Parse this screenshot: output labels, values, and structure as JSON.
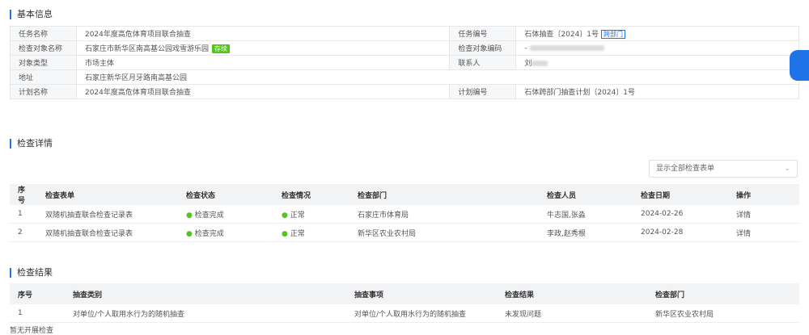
{
  "basic": {
    "title": "基本信息",
    "task_name_label": "任务名称",
    "task_name": "2024年度高危体育项目联合抽查",
    "task_no_label": "任务编号",
    "task_no": "石体抽查〔2024〕1号",
    "task_no_tag": "跨部门",
    "obj_name_label": "检查对象名称",
    "obj_name": "石家庄市新华区南高基公园戏雪游乐园",
    "obj_name_tag": "存续",
    "obj_code_label": "检查对象编码",
    "obj_code": "-",
    "obj_type_label": "对象类型",
    "obj_type": "市场主体",
    "contact_label": "联系人",
    "contact": "刘",
    "addr_label": "地址",
    "addr": "石家庄新华区月牙路南高基公园",
    "plan_name_label": "计划名称",
    "plan_name": "2024年度高危体育项目联合抽查",
    "plan_no_label": "计划编号",
    "plan_no": "石体跨部门抽查计划〔2024〕1号"
  },
  "details": {
    "title": "检查详情",
    "filter": "显示全部检查表单",
    "headers": [
      "序号",
      "检查表单",
      "检查状态",
      "检查情况",
      "检查部门",
      "检查人员",
      "检查日期",
      "操作"
    ],
    "rows": [
      {
        "no": "1",
        "form": "双随机抽查联合检查记录表",
        "state": "检查完成",
        "result": "正常",
        "dept": "石家庄市体育局",
        "staff": "牛志国,张淼",
        "date": "2024-02-26",
        "op": "详情"
      },
      {
        "no": "2",
        "form": "双随机抽查联合检查记录表",
        "state": "检查完成",
        "result": "正常",
        "dept": "新华区农业农村局",
        "staff": "李政,赵秀根",
        "date": "2024-02-28",
        "op": "详情"
      }
    ]
  },
  "results": {
    "title": "检查结果",
    "headers": [
      "序号",
      "抽查类别",
      "抽查事项",
      "检查结果",
      "检查部门"
    ],
    "rows": [
      {
        "no": "1",
        "cat": "对单位/个人取用水行为的随机抽查",
        "item": "对单位/个人取用水行为的随机抽查",
        "result": "未发现问题",
        "dept": "新华区农业农村局"
      }
    ]
  },
  "footer": "暂无开展检查"
}
